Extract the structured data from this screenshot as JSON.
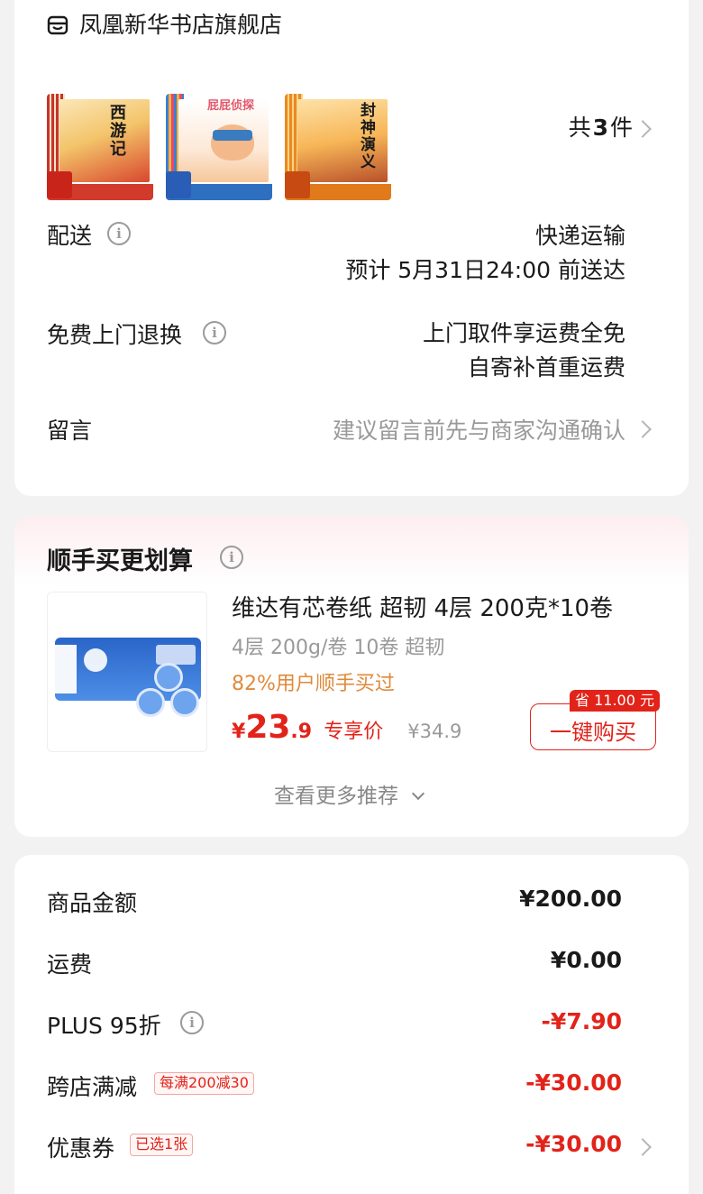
{
  "store": {
    "name": "凤凰新华书店旗舰店",
    "icon": "store-icon"
  },
  "products": {
    "thumbnails": [
      {
        "title": "西游记",
        "icon": "book-cover"
      },
      {
        "title": "屁屁侦探",
        "icon": "book-cover"
      },
      {
        "title": "封神演义",
        "icon": "book-cover"
      }
    ],
    "count_prefix": "共",
    "count": "3",
    "count_suffix": "件"
  },
  "delivery": {
    "label": "配送",
    "method": "快递运输",
    "eta": "预计 5月31日24:00 前送达"
  },
  "returns": {
    "label": "免费上门退换",
    "line1": "上门取件享运费全免",
    "line2": "自寄补首重运费"
  },
  "message": {
    "label": "留言",
    "placeholder": "建议留言前先与商家沟通确认"
  },
  "recommend": {
    "title": "顺手买更划算",
    "product_title": "维达有芯卷纸 超韧 4层 200克*10卷",
    "spec": "4层 200g/卷 10卷 超韧",
    "social_proof": "82%用户顺手买过",
    "price_symbol": "¥",
    "price_int": "23",
    "price_dec": ".9",
    "price_label": "专享价",
    "original_price": "¥34.9",
    "save_badge": "省 11.00 元",
    "buy_button": "一键购买",
    "more": "查看更多推荐"
  },
  "summary": {
    "rows": [
      {
        "label": "商品金额",
        "value": "¥200.00"
      },
      {
        "label": "运费",
        "value": "¥0.00"
      },
      {
        "label": "PLUS 95折",
        "value": "-¥7.90"
      },
      {
        "label": "跨店满减",
        "tag": "每满200减30",
        "value": "-¥30.00"
      },
      {
        "label": "优惠券",
        "tag": "已选1张",
        "value": "-¥30.00"
      }
    ]
  },
  "colors": {
    "accent_red": "#e2231a",
    "orange_text": "#e08a3a",
    "gray_text": "#999999"
  }
}
